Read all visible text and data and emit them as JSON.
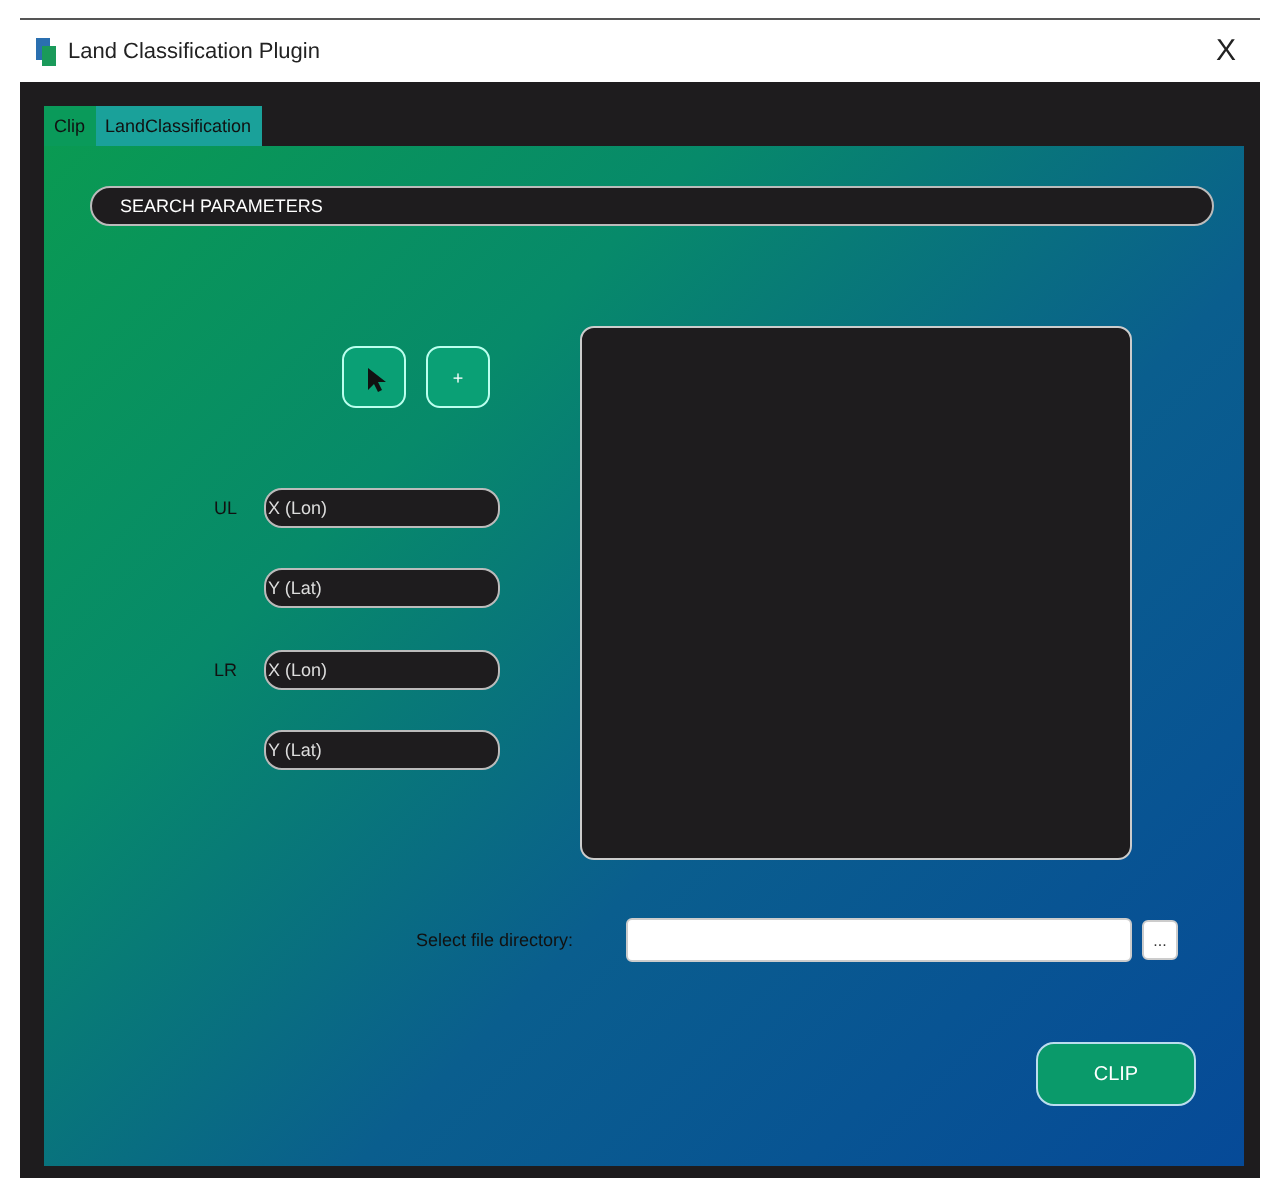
{
  "window": {
    "title": "Land Classification Plugin",
    "close": "X"
  },
  "tabs": [
    {
      "label": "Clip",
      "selected": true
    },
    {
      "label": "LandClassification",
      "selected": false
    }
  ],
  "search_bar": {
    "label": "SEARCH PARAMETERS"
  },
  "tool_buttons": [
    {
      "kind": "pointer"
    },
    {
      "kind": "text",
      "label": "+"
    }
  ],
  "coordinates": [
    {
      "label": "UL",
      "fields": [
        {
          "placeholder": "X (Lon)"
        },
        {
          "placeholder": "Y (Lat)"
        }
      ]
    },
    {
      "label": "LR",
      "fields": [
        {
          "placeholder": "X (Lon)"
        },
        {
          "placeholder": "Y (Lat)"
        }
      ]
    }
  ],
  "directory": {
    "label": "Select file directory:",
    "browse": "..."
  },
  "clip_button": "CLIP"
}
